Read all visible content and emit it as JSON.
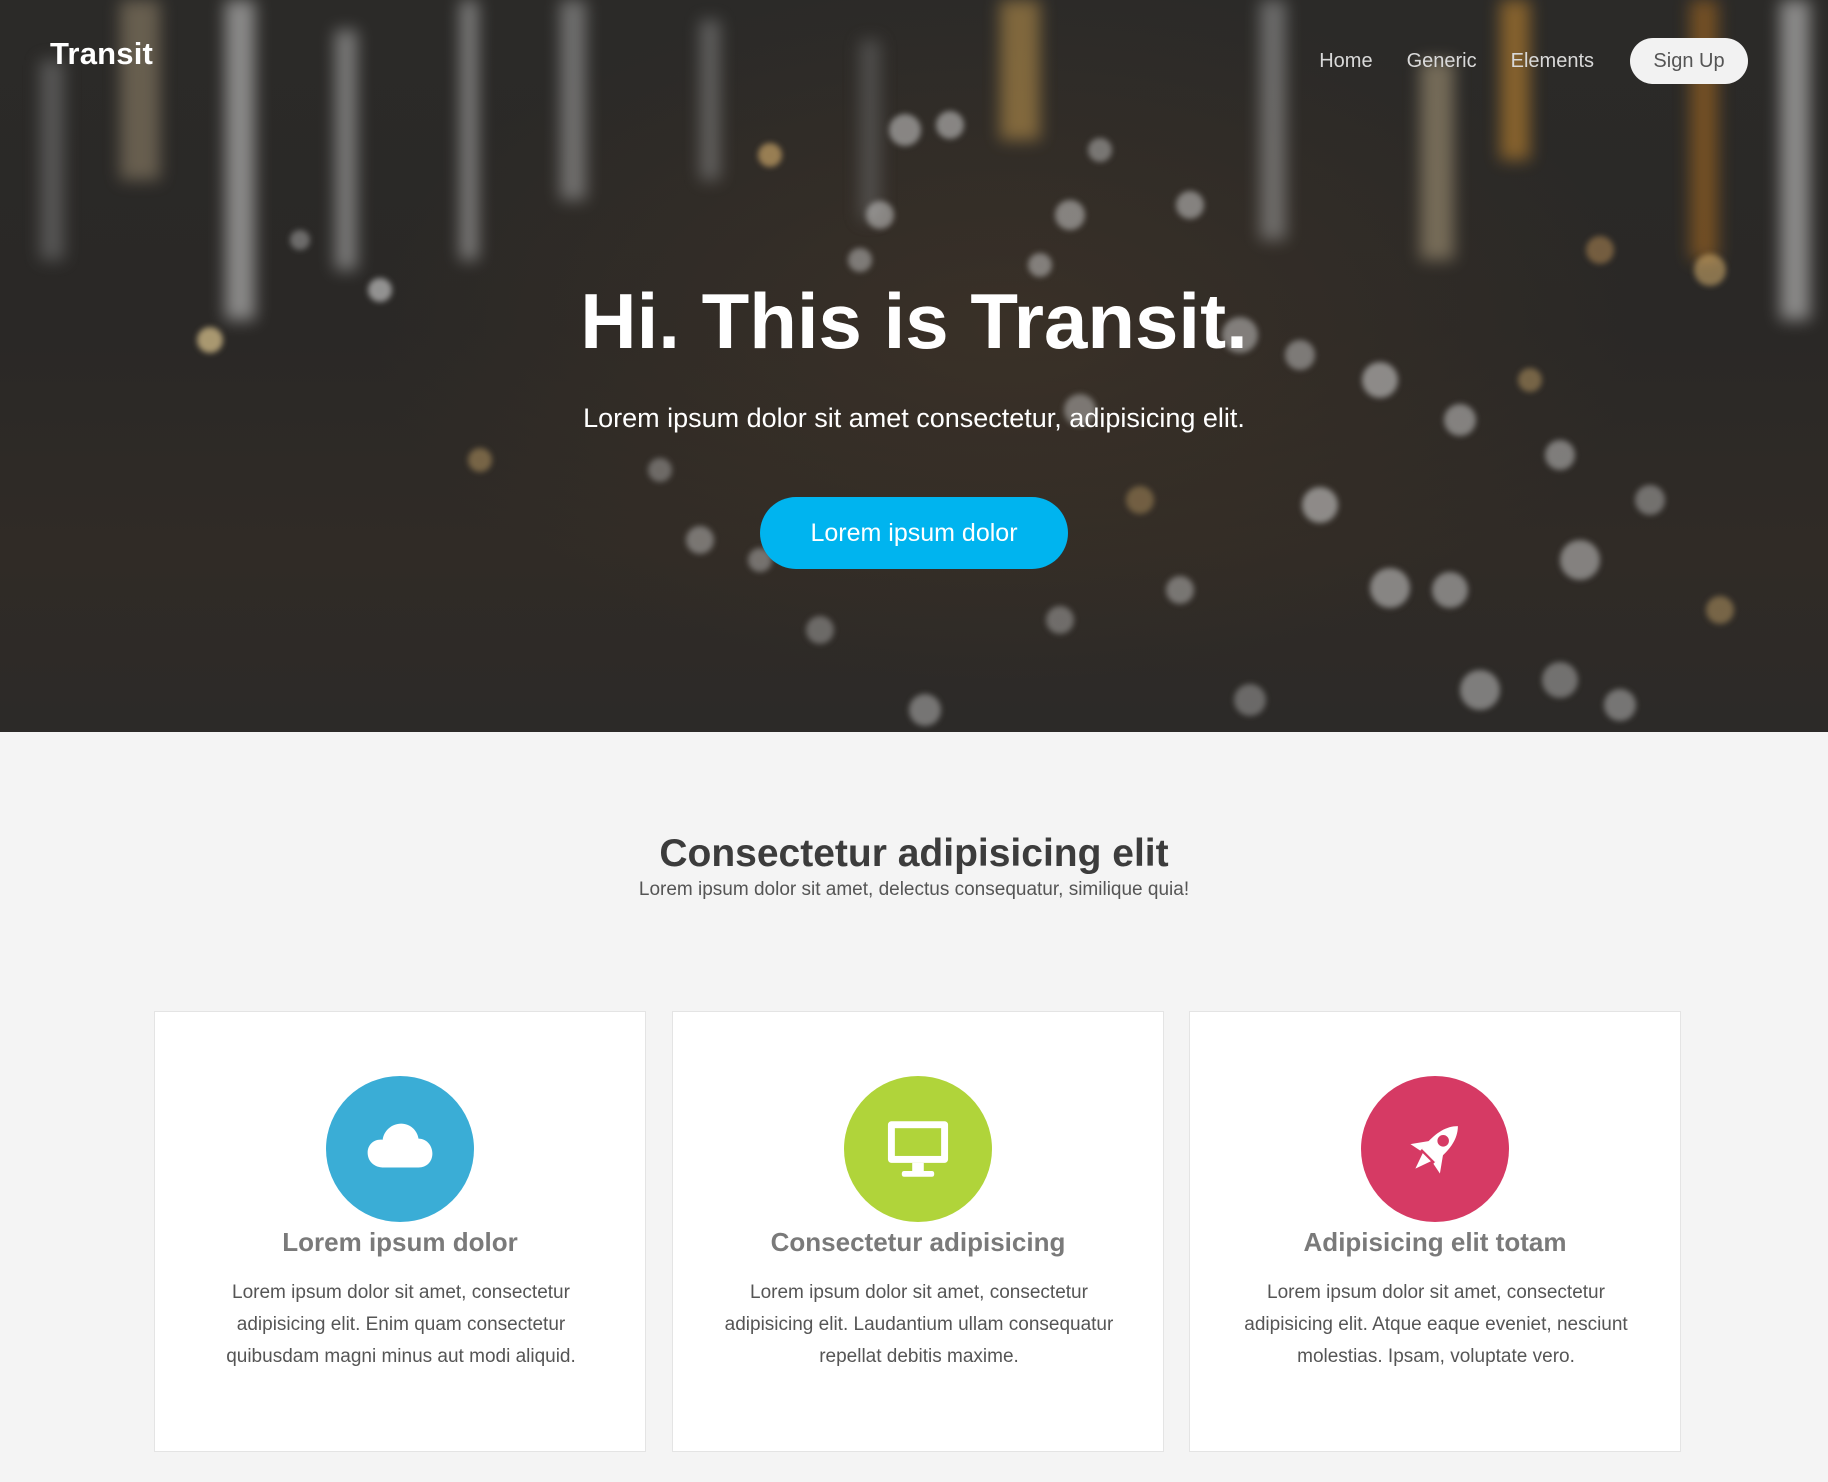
{
  "header": {
    "logo": "Transit",
    "nav": [
      "Home",
      "Generic",
      "Elements"
    ],
    "signup_label": "Sign Up"
  },
  "hero": {
    "title": "Hi. This is Transit.",
    "subtitle": "Lorem ipsum dolor sit amet consectetur, adipisicing elit.",
    "cta_label": "Lorem ipsum dolor",
    "cta_color": "#00b4ef"
  },
  "features": {
    "title": "Consectetur adipisicing elit",
    "subtitle": "Lorem ipsum dolor sit amet, delectus consequatur, similique quia!",
    "cards": [
      {
        "icon": "cloud-icon",
        "icon_color": "#3aadd6",
        "title": "Lorem ipsum dolor",
        "text": "Lorem ipsum dolor sit amet, consectetur adipisicing elit. Enim quam consectetur quibusdam magni minus aut modi aliquid."
      },
      {
        "icon": "desktop-icon",
        "icon_color": "#b0d43a",
        "title": "Consectetur adipisicing",
        "text": "Lorem ipsum dolor sit amet, consectetur adipisicing elit. Laudantium ullam consequatur repellat debitis maxime."
      },
      {
        "icon": "rocket-icon",
        "icon_color": "#d63a64",
        "title": "Adipisicing elit totam",
        "text": "Lorem ipsum dolor sit amet, consectetur adipisicing elit. Atque eaque eveniet, nesciunt molestias. Ipsam, voluptate vero."
      }
    ]
  }
}
